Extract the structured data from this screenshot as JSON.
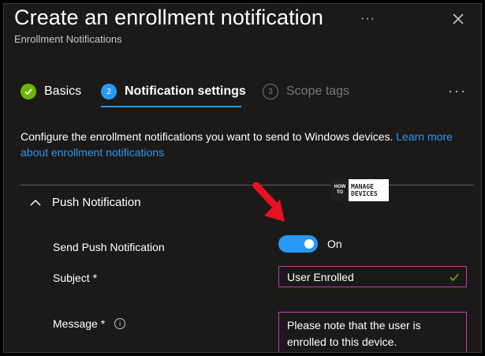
{
  "header": {
    "title": "Create an enrollment notification",
    "subtitle": "Enrollment Notifications",
    "more_label": "···"
  },
  "steps": [
    {
      "label": "Basics",
      "status": "completed",
      "icon": "checkmark-icon"
    },
    {
      "number": "2",
      "label": "Notification settings",
      "status": "active"
    },
    {
      "number": "3",
      "label": "Scope tags",
      "status": "inactive"
    }
  ],
  "steps_more_label": "···",
  "description": {
    "text": "Configure the enrollment notifications you want to send to Windows devices. ",
    "link": "Learn more about enrollment notifications"
  },
  "section": {
    "title": "Push Notification",
    "icon": "chevron-up-icon"
  },
  "watermark": {
    "left": [
      "HOW",
      "TO"
    ],
    "right": [
      "MANAGE",
      "DEVICES"
    ]
  },
  "form": {
    "push_label": "Send Push Notification",
    "push_toggle_value": "On",
    "subject_label": "Subject *",
    "subject_value": "User Enrolled",
    "message_label": "Message *",
    "message_value": "Please note that the user is enrolled to this device."
  },
  "colors": {
    "accent": "#2899f5",
    "success": "#6bb700",
    "field_border": "#c239b3",
    "arrow": "#e81123"
  }
}
